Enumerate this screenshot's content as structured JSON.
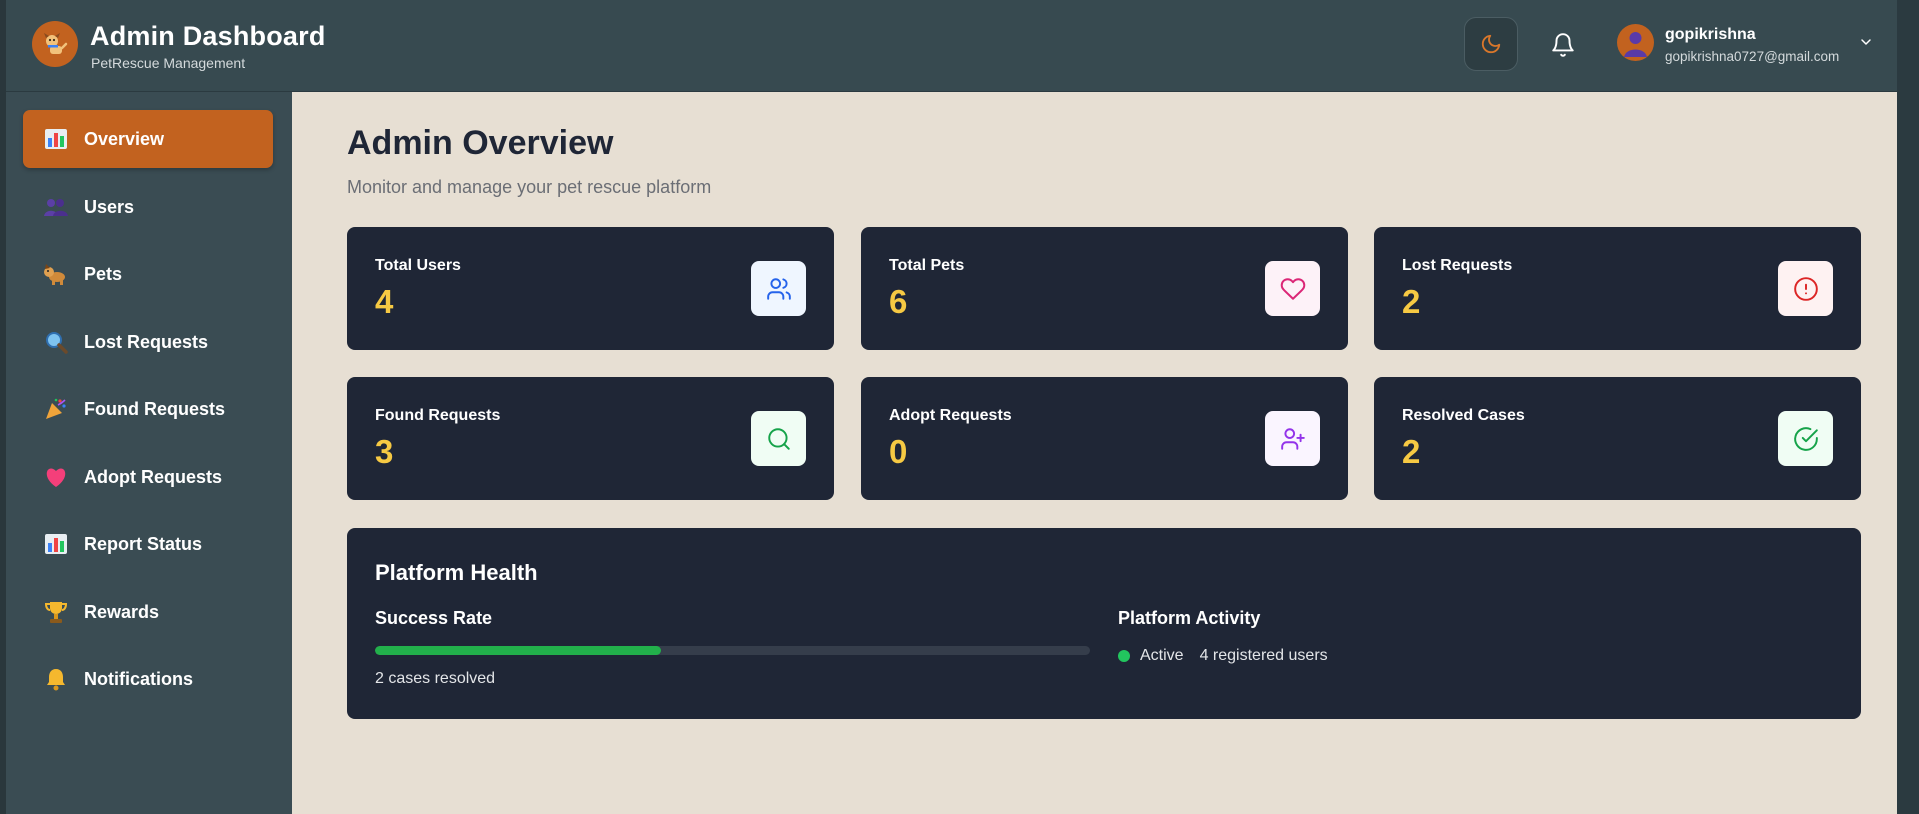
{
  "header": {
    "title": "Admin Dashboard",
    "subtitle": "PetRescue Management",
    "user_name": "gopikrishna",
    "user_email": "gopikrishna0727@gmail.com"
  },
  "sidebar": {
    "items": [
      {
        "label": "Overview",
        "icon": "bar-chart-icon",
        "active": true
      },
      {
        "label": "Users",
        "icon": "people-icon"
      },
      {
        "label": "Pets",
        "icon": "dog-icon"
      },
      {
        "label": "Lost Requests",
        "icon": "magnifier-icon"
      },
      {
        "label": "Found Requests",
        "icon": "party-popper-icon"
      },
      {
        "label": "Adopt Requests",
        "icon": "heart-icon"
      },
      {
        "label": "Report Status",
        "icon": "bar-chart-icon"
      },
      {
        "label": "Rewards",
        "icon": "trophy-icon"
      },
      {
        "label": "Notifications",
        "icon": "bell-icon"
      }
    ]
  },
  "main": {
    "title": "Admin Overview",
    "subtitle": "Monitor and manage your pet rescue platform",
    "stats": [
      {
        "label": "Total Users",
        "value": "4",
        "icon": "users-icon",
        "icon_color": "#2563eb"
      },
      {
        "label": "Total Pets",
        "value": "6",
        "icon": "heart-icon",
        "icon_color": "#db2777"
      },
      {
        "label": "Lost Requests",
        "value": "2",
        "icon": "alert-circle-icon",
        "icon_color": "#dc2626"
      },
      {
        "label": "Found Requests",
        "value": "3",
        "icon": "search-icon",
        "icon_color": "#16a34a"
      },
      {
        "label": "Adopt Requests",
        "value": "0",
        "icon": "user-plus-icon",
        "icon_color": "#9333ea"
      },
      {
        "label": "Resolved Cases",
        "value": "2",
        "icon": "check-circle-icon",
        "icon_color": "#16a34a"
      }
    ],
    "health": {
      "title": "Platform Health",
      "success_rate_label": "Success Rate",
      "success_rate_fraction": 0.4,
      "cases_resolved": "2 cases resolved",
      "activity_label": "Platform Activity",
      "activity_status": "Active",
      "registered_users": "4 registered users"
    }
  },
  "colors": {
    "accent": "#c2621f",
    "card_bg": "#1f2636",
    "stat_value": "#f6c943",
    "success": "#22b04b"
  }
}
